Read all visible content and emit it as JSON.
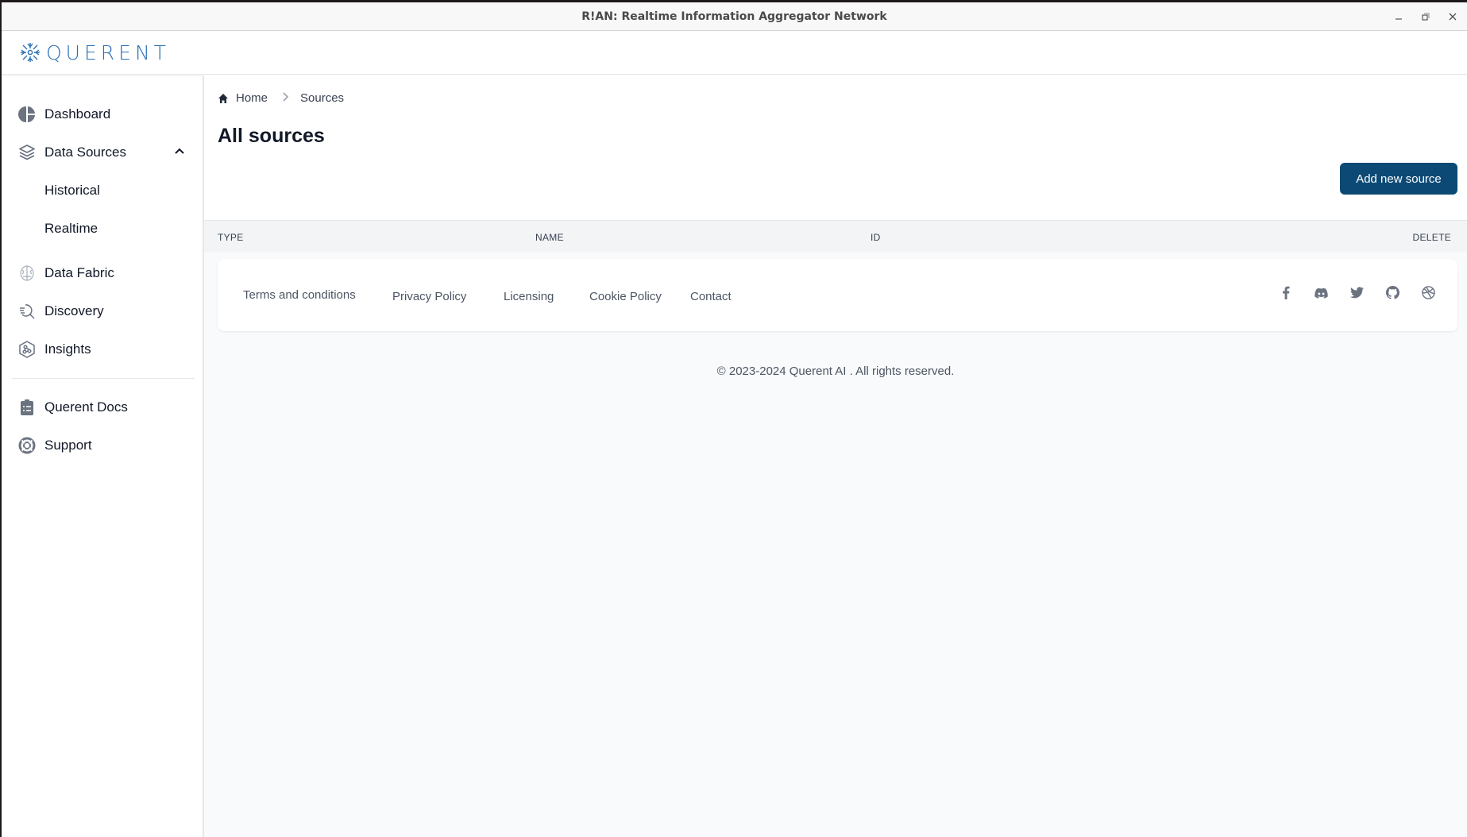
{
  "window": {
    "title": "R!AN: Realtime Information Aggregator Network",
    "controls": [
      "minimize",
      "restore",
      "close"
    ]
  },
  "brand": {
    "name": "QUERENT",
    "color": "#2a6fb6"
  },
  "sidebar": {
    "items": [
      {
        "label": "Dashboard",
        "icon": "pie-chart-icon"
      },
      {
        "label": "Data Sources",
        "icon": "layers-icon",
        "expanded": true,
        "children": [
          {
            "label": "Historical"
          },
          {
            "label": "Realtime"
          }
        ]
      },
      {
        "label": "Data Fabric",
        "icon": "brain-icon"
      },
      {
        "label": "Discovery",
        "icon": "search-list-icon"
      },
      {
        "label": "Insights",
        "icon": "network-hexagon-icon"
      }
    ],
    "secondary": [
      {
        "label": "Querent Docs",
        "icon": "clipboard-list-icon"
      },
      {
        "label": "Support",
        "icon": "lifebuoy-icon"
      }
    ]
  },
  "breadcrumb": {
    "items": [
      "Home",
      "Sources"
    ]
  },
  "page": {
    "title": "All sources",
    "add_button": "Add new source",
    "accent": "#0c4a75"
  },
  "table": {
    "columns": [
      "TYPE",
      "NAME",
      "ID",
      "DELETE"
    ],
    "rows": []
  },
  "footer": {
    "links": [
      "Terms and conditions",
      "Privacy Policy",
      "Licensing",
      "Cookie Policy",
      "Contact"
    ],
    "social": [
      "facebook-icon",
      "discord-icon",
      "twitter-icon",
      "github-icon",
      "dribbble-icon"
    ],
    "copyright": "© 2023-2024 Querent AI . All rights reserved."
  }
}
